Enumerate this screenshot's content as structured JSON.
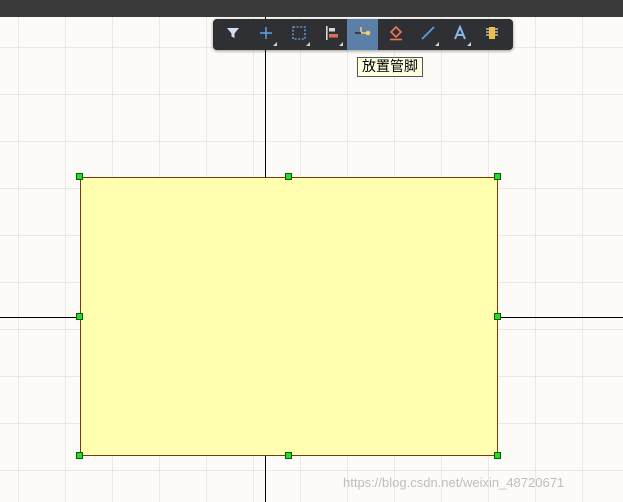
{
  "toolbar": {
    "buttons": [
      {
        "icon": "filter-icon",
        "has_menu": false
      },
      {
        "icon": "plus-icon",
        "has_menu": true
      },
      {
        "icon": "select-rect-icon",
        "has_menu": true
      },
      {
        "icon": "align-icon",
        "has_menu": true
      },
      {
        "icon": "place-pin-icon",
        "has_menu": false,
        "active": true
      },
      {
        "icon": "eraser-icon",
        "has_menu": false
      },
      {
        "icon": "line-icon",
        "has_menu": true
      },
      {
        "icon": "text-icon",
        "has_menu": true
      },
      {
        "icon": "component-icon",
        "has_menu": false
      }
    ],
    "tooltip": "放置管脚"
  },
  "colors": {
    "canvas_bg": "#fdfbf7",
    "component_fill": "#ffffaf",
    "handle": "#22dd22",
    "toolbar_bg": "#2f3033",
    "active_button": "#5b7fa6"
  },
  "watermark": "https://blog.csdn.net/weixin_48720671"
}
